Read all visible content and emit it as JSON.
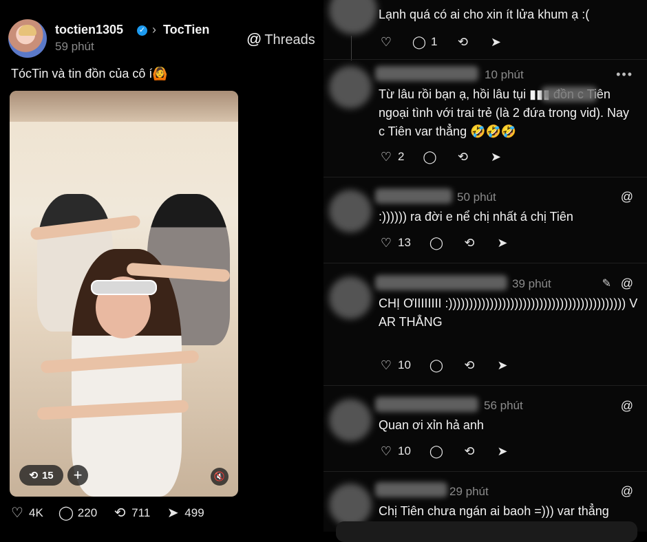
{
  "post": {
    "username": "toctien1305",
    "channel": "TocTien",
    "time": "59 phút",
    "threads_label": "Threads",
    "caption": "TócTin và tin đồn của cô í🙆",
    "video": {
      "remix_count": "15",
      "plus": "+"
    },
    "stats": {
      "likes": "4K",
      "comments": "220",
      "reposts": "711",
      "shares": "499"
    }
  },
  "comments": [
    {
      "time": "",
      "text": "Lạnh quá có ai cho xin ít lửa khum ạ :(",
      "likes": "",
      "replies": "1"
    },
    {
      "time": "10 phút",
      "text": "Từ lâu rồi bạn ạ, hồi lâu tụi ▮▮▮ đồn c Tiên ngoại tình với trai trẻ (là 2 đứa trong vid). Nay c Tiên var thẳng 🤣🤣🤣",
      "likes": "2",
      "replies": ""
    },
    {
      "time": "50 phút",
      "text": ":)))))) ra đời e nể chị nhất á chị Tiên",
      "likes": "13",
      "replies": ""
    },
    {
      "time": "39 phút",
      "text": "CHỊ ƠIIIIIIII :))))))))))))))))))))))))))))))))))))))))))) VAR THẲNG",
      "likes": "10",
      "replies": ""
    },
    {
      "time": "56 phút",
      "text": "Quan ơi xỉn hả anh",
      "likes": "10",
      "replies": ""
    },
    {
      "time": "29 phút",
      "text": "Chị Tiên chưa ngán ai baoh =))) var thẳng",
      "likes": "",
      "replies": ""
    }
  ],
  "colors": {
    "background": "#000000",
    "verified": "#1d9bf0",
    "muted": "#8a8a8a"
  },
  "icons": [
    "heart-icon",
    "comment-icon",
    "repost-icon",
    "share-icon",
    "threads-icon",
    "edit-icon",
    "more-icon",
    "mute-icon",
    "verified-icon"
  ]
}
